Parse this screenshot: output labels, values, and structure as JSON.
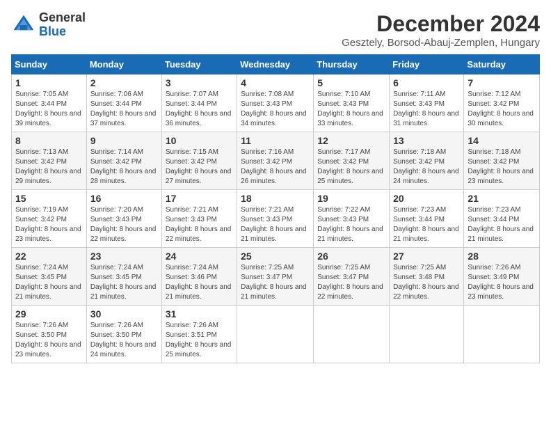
{
  "header": {
    "logo_general": "General",
    "logo_blue": "Blue",
    "month_title": "December 2024",
    "location": "Gesztely, Borsod-Abauj-Zemplen, Hungary"
  },
  "days_of_week": [
    "Sunday",
    "Monday",
    "Tuesday",
    "Wednesday",
    "Thursday",
    "Friday",
    "Saturday"
  ],
  "weeks": [
    [
      {
        "day": "1",
        "sunrise": "Sunrise: 7:05 AM",
        "sunset": "Sunset: 3:44 PM",
        "daylight": "Daylight: 8 hours and 39 minutes."
      },
      {
        "day": "2",
        "sunrise": "Sunrise: 7:06 AM",
        "sunset": "Sunset: 3:44 PM",
        "daylight": "Daylight: 8 hours and 37 minutes."
      },
      {
        "day": "3",
        "sunrise": "Sunrise: 7:07 AM",
        "sunset": "Sunset: 3:44 PM",
        "daylight": "Daylight: 8 hours and 36 minutes."
      },
      {
        "day": "4",
        "sunrise": "Sunrise: 7:08 AM",
        "sunset": "Sunset: 3:43 PM",
        "daylight": "Daylight: 8 hours and 34 minutes."
      },
      {
        "day": "5",
        "sunrise": "Sunrise: 7:10 AM",
        "sunset": "Sunset: 3:43 PM",
        "daylight": "Daylight: 8 hours and 33 minutes."
      },
      {
        "day": "6",
        "sunrise": "Sunrise: 7:11 AM",
        "sunset": "Sunset: 3:43 PM",
        "daylight": "Daylight: 8 hours and 31 minutes."
      },
      {
        "day": "7",
        "sunrise": "Sunrise: 7:12 AM",
        "sunset": "Sunset: 3:42 PM",
        "daylight": "Daylight: 8 hours and 30 minutes."
      }
    ],
    [
      {
        "day": "8",
        "sunrise": "Sunrise: 7:13 AM",
        "sunset": "Sunset: 3:42 PM",
        "daylight": "Daylight: 8 hours and 29 minutes."
      },
      {
        "day": "9",
        "sunrise": "Sunrise: 7:14 AM",
        "sunset": "Sunset: 3:42 PM",
        "daylight": "Daylight: 8 hours and 28 minutes."
      },
      {
        "day": "10",
        "sunrise": "Sunrise: 7:15 AM",
        "sunset": "Sunset: 3:42 PM",
        "daylight": "Daylight: 8 hours and 27 minutes."
      },
      {
        "day": "11",
        "sunrise": "Sunrise: 7:16 AM",
        "sunset": "Sunset: 3:42 PM",
        "daylight": "Daylight: 8 hours and 26 minutes."
      },
      {
        "day": "12",
        "sunrise": "Sunrise: 7:17 AM",
        "sunset": "Sunset: 3:42 PM",
        "daylight": "Daylight: 8 hours and 25 minutes."
      },
      {
        "day": "13",
        "sunrise": "Sunrise: 7:18 AM",
        "sunset": "Sunset: 3:42 PM",
        "daylight": "Daylight: 8 hours and 24 minutes."
      },
      {
        "day": "14",
        "sunrise": "Sunrise: 7:18 AM",
        "sunset": "Sunset: 3:42 PM",
        "daylight": "Daylight: 8 hours and 23 minutes."
      }
    ],
    [
      {
        "day": "15",
        "sunrise": "Sunrise: 7:19 AM",
        "sunset": "Sunset: 3:42 PM",
        "daylight": "Daylight: 8 hours and 23 minutes."
      },
      {
        "day": "16",
        "sunrise": "Sunrise: 7:20 AM",
        "sunset": "Sunset: 3:43 PM",
        "daylight": "Daylight: 8 hours and 22 minutes."
      },
      {
        "day": "17",
        "sunrise": "Sunrise: 7:21 AM",
        "sunset": "Sunset: 3:43 PM",
        "daylight": "Daylight: 8 hours and 22 minutes."
      },
      {
        "day": "18",
        "sunrise": "Sunrise: 7:21 AM",
        "sunset": "Sunset: 3:43 PM",
        "daylight": "Daylight: 8 hours and 21 minutes."
      },
      {
        "day": "19",
        "sunrise": "Sunrise: 7:22 AM",
        "sunset": "Sunset: 3:43 PM",
        "daylight": "Daylight: 8 hours and 21 minutes."
      },
      {
        "day": "20",
        "sunrise": "Sunrise: 7:23 AM",
        "sunset": "Sunset: 3:44 PM",
        "daylight": "Daylight: 8 hours and 21 minutes."
      },
      {
        "day": "21",
        "sunrise": "Sunrise: 7:23 AM",
        "sunset": "Sunset: 3:44 PM",
        "daylight": "Daylight: 8 hours and 21 minutes."
      }
    ],
    [
      {
        "day": "22",
        "sunrise": "Sunrise: 7:24 AM",
        "sunset": "Sunset: 3:45 PM",
        "daylight": "Daylight: 8 hours and 21 minutes."
      },
      {
        "day": "23",
        "sunrise": "Sunrise: 7:24 AM",
        "sunset": "Sunset: 3:45 PM",
        "daylight": "Daylight: 8 hours and 21 minutes."
      },
      {
        "day": "24",
        "sunrise": "Sunrise: 7:24 AM",
        "sunset": "Sunset: 3:46 PM",
        "daylight": "Daylight: 8 hours and 21 minutes."
      },
      {
        "day": "25",
        "sunrise": "Sunrise: 7:25 AM",
        "sunset": "Sunset: 3:47 PM",
        "daylight": "Daylight: 8 hours and 21 minutes."
      },
      {
        "day": "26",
        "sunrise": "Sunrise: 7:25 AM",
        "sunset": "Sunset: 3:47 PM",
        "daylight": "Daylight: 8 hours and 22 minutes."
      },
      {
        "day": "27",
        "sunrise": "Sunrise: 7:25 AM",
        "sunset": "Sunset: 3:48 PM",
        "daylight": "Daylight: 8 hours and 22 minutes."
      },
      {
        "day": "28",
        "sunrise": "Sunrise: 7:26 AM",
        "sunset": "Sunset: 3:49 PM",
        "daylight": "Daylight: 8 hours and 23 minutes."
      }
    ],
    [
      {
        "day": "29",
        "sunrise": "Sunrise: 7:26 AM",
        "sunset": "Sunset: 3:50 PM",
        "daylight": "Daylight: 8 hours and 23 minutes."
      },
      {
        "day": "30",
        "sunrise": "Sunrise: 7:26 AM",
        "sunset": "Sunset: 3:50 PM",
        "daylight": "Daylight: 8 hours and 24 minutes."
      },
      {
        "day": "31",
        "sunrise": "Sunrise: 7:26 AM",
        "sunset": "Sunset: 3:51 PM",
        "daylight": "Daylight: 8 hours and 25 minutes."
      },
      null,
      null,
      null,
      null
    ]
  ]
}
